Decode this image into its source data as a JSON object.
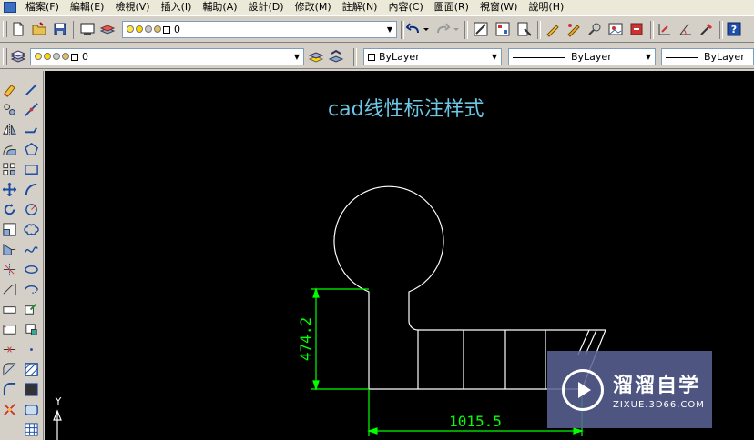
{
  "menu": {
    "items": [
      "檔案(F)",
      "編輯(E)",
      "檢視(V)",
      "插入(I)",
      "輔助(A)",
      "設計(D)",
      "修改(M)",
      "註解(N)",
      "內容(C)",
      "圖面(R)",
      "視窗(W)",
      "說明(H)"
    ]
  },
  "toolbar1": {
    "layer_combo_value": "0"
  },
  "toolbar2": {
    "layer_combo_value": "0",
    "color_combo_value": "ByLayer",
    "linetype_combo_value": "ByLayer",
    "lineweight_combo_value": "ByLayer"
  },
  "drawing": {
    "title": "cad线性标注样式",
    "dim_vertical": "474.2",
    "dim_horizontal": "1015.5",
    "ucs_y_label": "Y",
    "colors": {
      "background": "#000000",
      "geometry": "#ffffff",
      "dimension": "#00ff00",
      "title": "#6cc7e6"
    }
  },
  "watermark": {
    "name": "溜溜自学",
    "url": "ZIXUE.3D66.COM"
  }
}
